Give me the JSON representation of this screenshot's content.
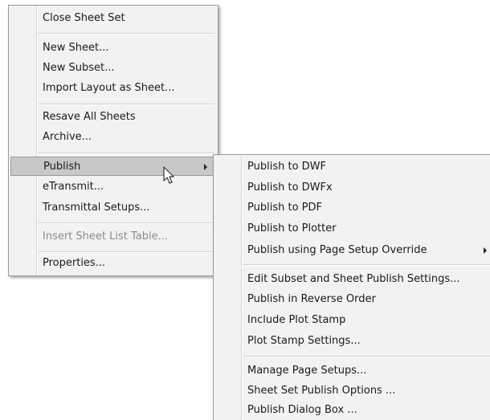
{
  "main_menu": {
    "items": [
      {
        "label": "Close Sheet Set"
      },
      {
        "label": "New Sheet..."
      },
      {
        "label": "New Subset..."
      },
      {
        "label": "Import Layout as Sheet..."
      },
      {
        "label": "Resave All Sheets"
      },
      {
        "label": "Archive..."
      },
      {
        "label": "Publish",
        "highlighted": true,
        "has_submenu": true
      },
      {
        "label": "eTransmit..."
      },
      {
        "label": "Transmittal Setups..."
      },
      {
        "label": "Insert Sheet List Table...",
        "disabled": true
      },
      {
        "label": "Properties..."
      }
    ]
  },
  "publish_submenu": {
    "items": [
      {
        "label": "Publish to DWF"
      },
      {
        "label": "Publish to DWFx"
      },
      {
        "label": "Publish to PDF"
      },
      {
        "label": "Publish to Plotter"
      },
      {
        "label": "Publish using Page Setup Override",
        "has_submenu": true
      },
      {
        "label": "Edit Subset and Sheet Publish Settings..."
      },
      {
        "label": "Publish in Reverse Order"
      },
      {
        "label": "Include Plot Stamp"
      },
      {
        "label": "Plot Stamp Settings..."
      },
      {
        "label": "Manage Page Setups..."
      },
      {
        "label": "Sheet Set Publish Options ..."
      },
      {
        "label": "Publish Dialog Box ..."
      }
    ]
  },
  "icons": {
    "pointer": "mouse-pointer-icon",
    "submenu": "chevron-right-icon"
  }
}
